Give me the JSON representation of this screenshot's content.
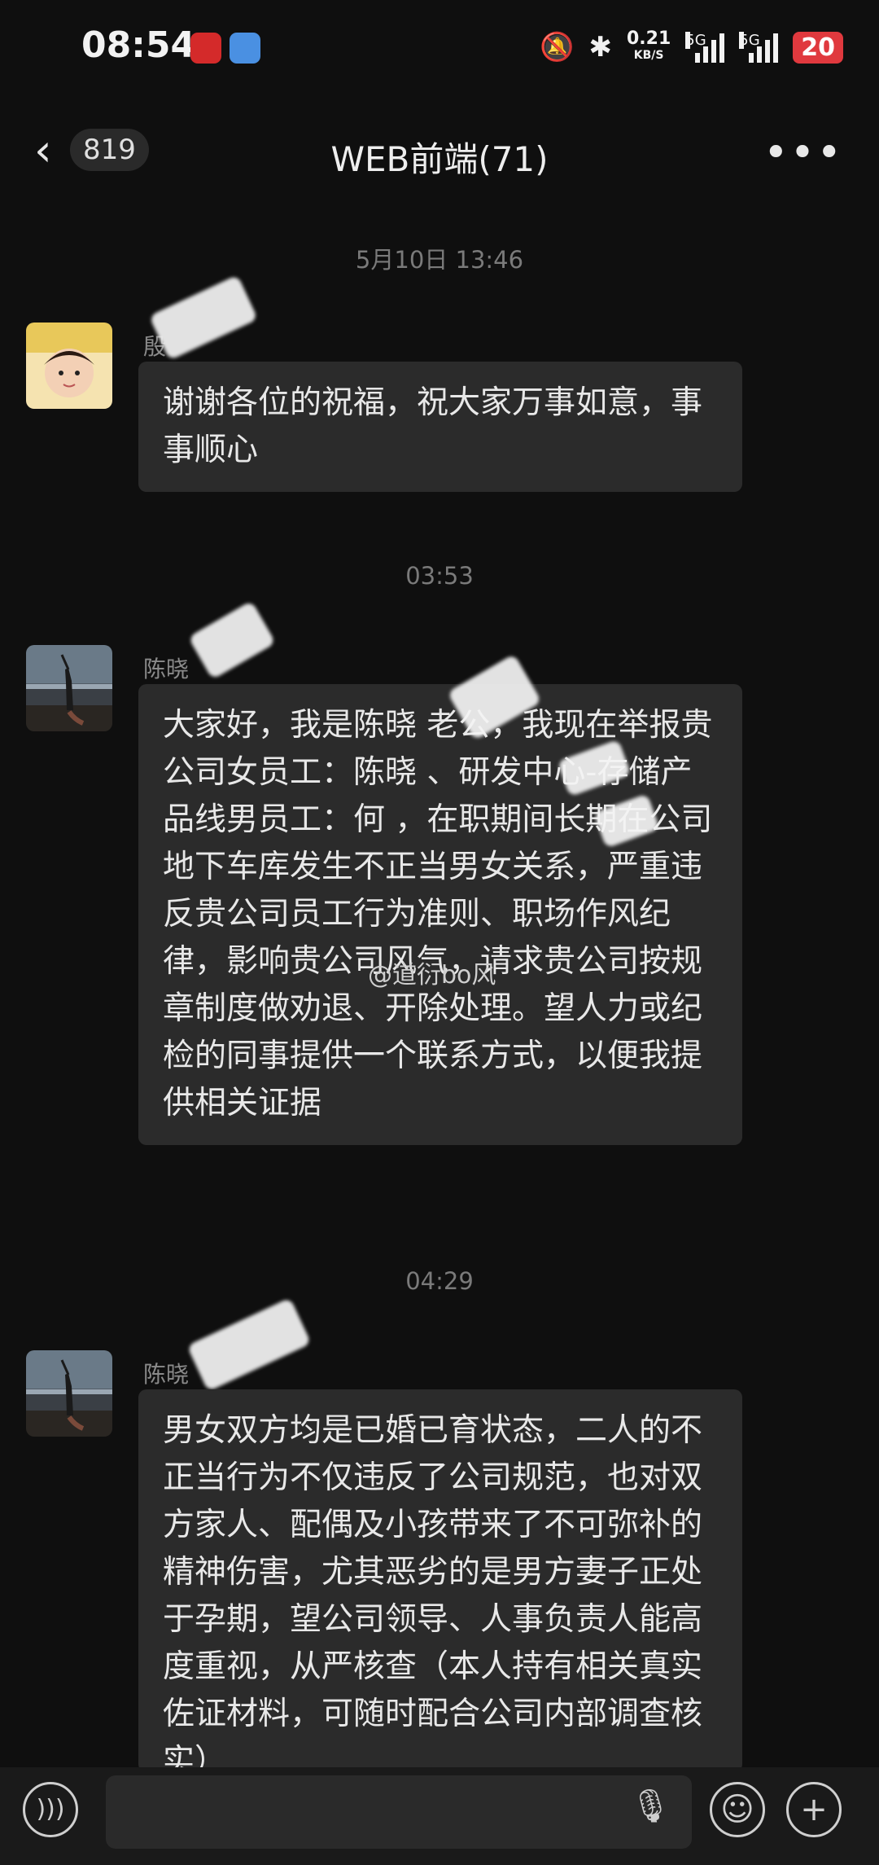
{
  "status_bar": {
    "time": "08:54",
    "speed_value": "0.21",
    "speed_unit": "KB/S",
    "sig1_label": "5G",
    "sig2_label": "5G",
    "battery": "20",
    "icons": [
      "china-merchants-bank-icon",
      "weather-icon",
      "mute-icon",
      "bluetooth-icon",
      "signal-icon",
      "signal-icon",
      "battery-icon"
    ]
  },
  "header": {
    "back_icon": "chevron-left-icon",
    "unread_count": "819",
    "title": "WEB前端(71)",
    "more_icon": "more-icon"
  },
  "chat": {
    "timestamps": [
      "5月10日 13:46",
      "03:53",
      "04:29"
    ],
    "messages": [
      {
        "sender": "殷",
        "text": "谢谢各位的祝福，祝大家万事如意，事事顺心"
      },
      {
        "sender": "陈晓",
        "text": "大家好，我是陈晓  老公，我现在举报贵公司女员工：陈晓  、研发中心-存储产品线男员工：何  ，在职期间长期在公司地下车库发生不正当男女关系，严重违反贵公司员工行为准则、职场作风纪律，影响贵公司风气，请求贵公司按规章制度做劝退、开除处理。望人力或纪检的同事提供一个联系方式，以便我提供相关证据"
      },
      {
        "sender": "陈晓",
        "text": "男女双方均是已婚已育状态，二人的不正当行为不仅违反了公司规范，也对双方家人、配偶及小孩带来了不可弥补的精神伤害，尤其恶劣的是男方妻子正处于孕期，望公司领导、人事负责人能高度重视，从严核查（本人持有相关真实佐证材料，可随时配合公司内部调查核实）"
      }
    ]
  },
  "watermark": "@道衍bo风",
  "input_bar": {
    "voice_icon": "voice-icon",
    "mic_icon": "mic-icon",
    "emoji_icon": "emoji-icon",
    "plus_icon": "plus-icon"
  }
}
